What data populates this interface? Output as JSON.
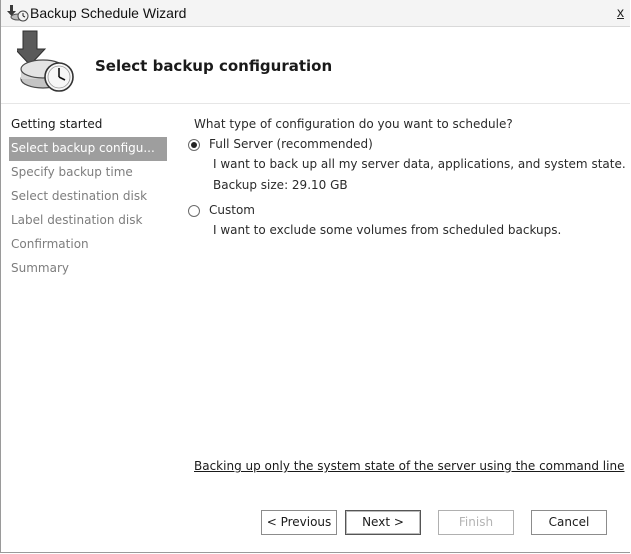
{
  "window": {
    "title": "Backup Schedule Wizard",
    "close_label": "x"
  },
  "header": {
    "title": "Select backup configuration"
  },
  "steps": [
    {
      "label": "Getting started",
      "state": "done"
    },
    {
      "label": "Select backup configu...",
      "state": "active"
    },
    {
      "label": "Specify backup time",
      "state": "pending"
    },
    {
      "label": "Select destination disk",
      "state": "pending"
    },
    {
      "label": "Label destination disk",
      "state": "pending"
    },
    {
      "label": "Confirmation",
      "state": "pending"
    },
    {
      "label": "Summary",
      "state": "pending"
    }
  ],
  "content": {
    "question": "What type of configuration do you want to schedule?",
    "options": [
      {
        "label": "Full Server (recommended)",
        "selected": true,
        "description": "I want to back up all my server data, applications, and system state.",
        "detail": "Backup size: 29.10 GB"
      },
      {
        "label": "Custom",
        "selected": false,
        "description": "I want to exclude some volumes from scheduled backups."
      }
    ],
    "command_link": "Backing up only the system state of the server using the command line"
  },
  "buttons": {
    "previous": "< Previous",
    "next": "Next >",
    "finish": "Finish",
    "cancel": "Cancel"
  },
  "icons": {
    "title": "backup-wizard-icon",
    "header": "backup-clock-icon"
  }
}
